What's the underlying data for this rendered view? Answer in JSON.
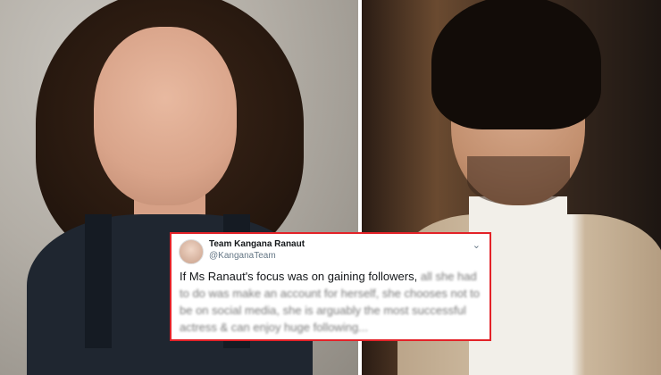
{
  "tweet": {
    "display_name": "Team Kangana Ranaut",
    "handle": "@KanganaTeam",
    "text_clear": "If Ms Ranaut's focus was on gaining followers,",
    "text_blurred": " all she had to do was make an account for herself, she chooses not to be on social media, she is arguably the most successful actress & can enjoy huge following...",
    "border_color": "#e32228",
    "menu_icon": "chevron-down-icon"
  }
}
